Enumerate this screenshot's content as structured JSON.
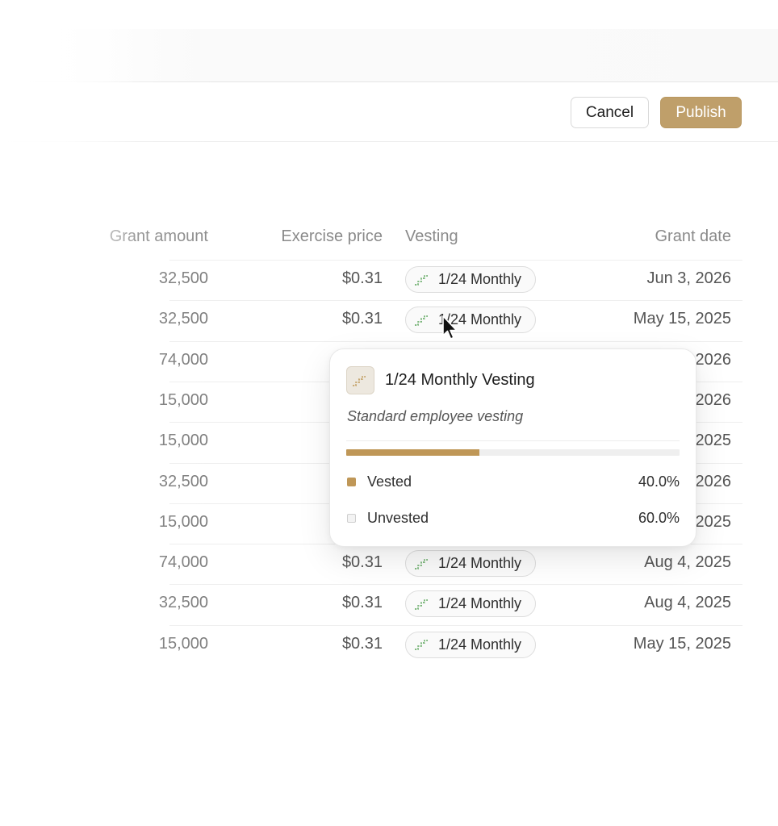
{
  "actions": {
    "cancel_label": "Cancel",
    "publish_label": "Publish"
  },
  "table": {
    "headers": {
      "grant_amount": "Grant amount",
      "exercise_price": "Exercise price",
      "vesting": "Vesting",
      "grant_date": "Grant date"
    },
    "rows": [
      {
        "grant_amount": "32,500",
        "exercise_price": "$0.31",
        "vesting": "1/24 Monthly",
        "grant_date": "Jun 3, 2026"
      },
      {
        "grant_amount": "32,500",
        "exercise_price": "$0.31",
        "vesting": "1/24 Monthly",
        "grant_date": "May 15, 2025"
      },
      {
        "grant_amount": "74,000",
        "exercise_price": "",
        "vesting": "",
        "grant_date": "2026"
      },
      {
        "grant_amount": "15,000",
        "exercise_price": "",
        "vesting": "",
        "grant_date": "2026"
      },
      {
        "grant_amount": "15,000",
        "exercise_price": "",
        "vesting": "",
        "grant_date": "2025"
      },
      {
        "grant_amount": "32,500",
        "exercise_price": "",
        "vesting": "",
        "grant_date": "2026"
      },
      {
        "grant_amount": "15,000",
        "exercise_price": "",
        "vesting": "",
        "grant_date": "2025"
      },
      {
        "grant_amount": "74,000",
        "exercise_price": "$0.31",
        "vesting": "1/24 Monthly",
        "grant_date": "Aug 4, 2025"
      },
      {
        "grant_amount": "32,500",
        "exercise_price": "$0.31",
        "vesting": "1/24 Monthly",
        "grant_date": "Aug 4, 2025"
      },
      {
        "grant_amount": "15,000",
        "exercise_price": "$0.31",
        "vesting": "1/24 Monthly",
        "grant_date": "May 15, 2025"
      }
    ]
  },
  "popover": {
    "icon": "stairs-icon",
    "title": "1/24 Monthly Vesting",
    "subtitle": "Standard employee vesting",
    "vested_fraction": 0.4,
    "legend": [
      {
        "label": "Vested",
        "value": "40.0%",
        "color": "#bf9757"
      },
      {
        "label": "Unvested",
        "value": "60.0%",
        "color": "#e6e6e6"
      }
    ]
  },
  "colors": {
    "accent": "#bf9f6a",
    "vesting_icon_green": "#5aa55a"
  }
}
